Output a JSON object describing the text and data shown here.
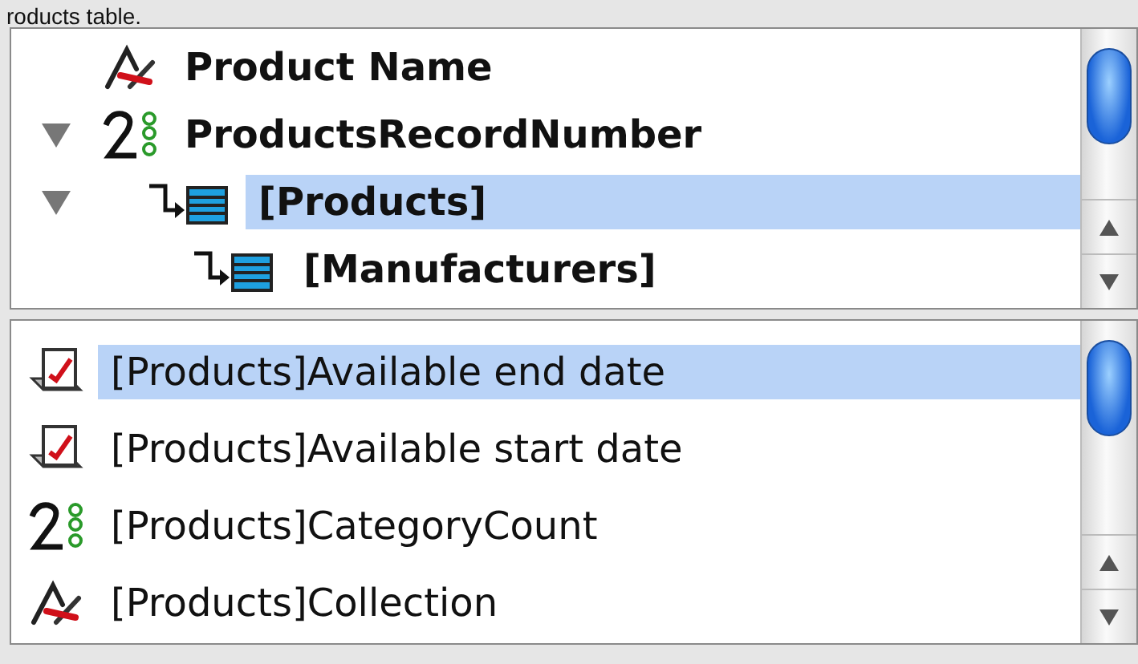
{
  "caption": "roducts table.",
  "field_tree": [
    {
      "kind": "text",
      "label": "Product Name",
      "selected": false
    },
    {
      "kind": "number",
      "label": "ProductsRecordNumber",
      "selected": false,
      "expanded": true,
      "children": [
        {
          "kind": "relation",
          "label": "[Products]",
          "selected": true,
          "expanded": true,
          "children": [
            {
              "kind": "relation",
              "label": "[Manufacturers]",
              "selected": false
            }
          ]
        }
      ]
    }
  ],
  "field_list": [
    {
      "kind": "date",
      "label": "[Products]Available end date",
      "selected": true
    },
    {
      "kind": "date",
      "label": "[Products]Available start date",
      "selected": false
    },
    {
      "kind": "number",
      "label": "[Products]CategoryCount",
      "selected": false
    },
    {
      "kind": "text",
      "label": "[Products]Collection",
      "selected": false
    }
  ]
}
